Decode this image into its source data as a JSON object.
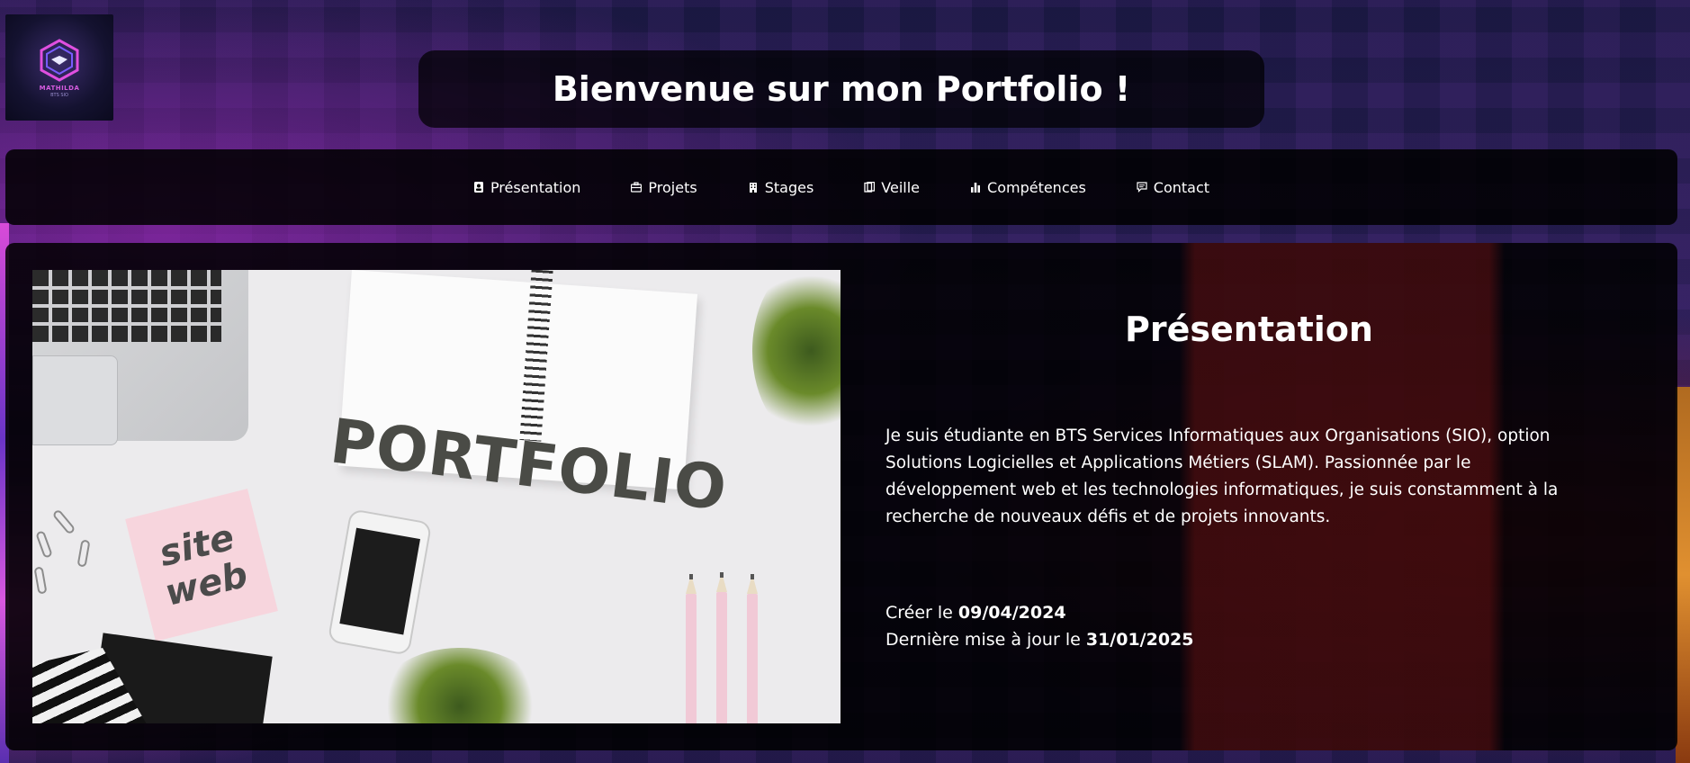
{
  "header": {
    "title": "Bienvenue sur mon Portfolio !",
    "logo": {
      "name": "MATHILDA",
      "subtitle": "BTS SIO",
      "icon": "hexagon-emblem"
    }
  },
  "nav": {
    "items": [
      {
        "label": "Présentation",
        "icon": "person-badge-icon"
      },
      {
        "label": "Projets",
        "icon": "briefcase-icon"
      },
      {
        "label": "Stages",
        "icon": "building-icon"
      },
      {
        "label": "Veille",
        "icon": "book-icon"
      },
      {
        "label": "Compétences",
        "icon": "bar-chart-icon"
      },
      {
        "label": "Contact",
        "icon": "chat-icon"
      }
    ]
  },
  "hero_image": {
    "headline": "PORTFOLIO",
    "sticky_line1": "site",
    "sticky_line2": "web"
  },
  "presentation": {
    "heading": "Présentation",
    "description": "Je suis étudiante en BTS Services Informatiques aux Organisations (SIO), option Solutions Logicielles et Applications Métiers (SLAM). Passionnée par le développement web et les technologies informatiques, je suis constamment à la recherche de nouveaux défis et de projets innovants.",
    "created_label": "Créer le",
    "created_date": "09/04/2024",
    "updated_label": "Dernière mise à jour le",
    "updated_date": "31/01/2025"
  },
  "colors": {
    "panel_bg": "#000000",
    "text": "#ffffff",
    "accent_pink": "#d65ce0"
  }
}
